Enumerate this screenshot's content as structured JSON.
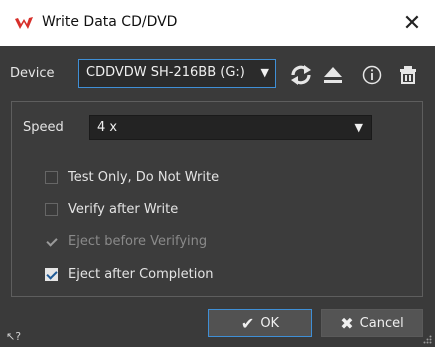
{
  "window": {
    "title": "Write Data CD/DVD",
    "close_glyph": "✕"
  },
  "device": {
    "label": "Device",
    "value": "CDDVDW SH-216BB (G:)",
    "arrow": "▼",
    "icons": [
      "refresh-icon",
      "eject-icon",
      "info-icon",
      "erase-icon"
    ]
  },
  "speed": {
    "label": "Speed",
    "value": "4 x",
    "arrow": "▼"
  },
  "options": [
    {
      "label": "Test Only, Do Not Write",
      "checked": false,
      "enabled": true
    },
    {
      "label": "Verify after Write",
      "checked": false,
      "enabled": true
    },
    {
      "label": "Eject before Verifying",
      "checked": true,
      "enabled": false
    },
    {
      "label": "Eject after Completion",
      "checked": true,
      "enabled": true
    }
  ],
  "buttons": {
    "ok_label": "OK",
    "ok_glyph": "✔",
    "cancel_label": "Cancel",
    "cancel_glyph": "✖"
  },
  "footer": {
    "help_glyph": "↖?"
  },
  "colors": {
    "accent": "#3f8fd6",
    "background": "#3a3a3a",
    "app_icon": "#d7302b"
  }
}
